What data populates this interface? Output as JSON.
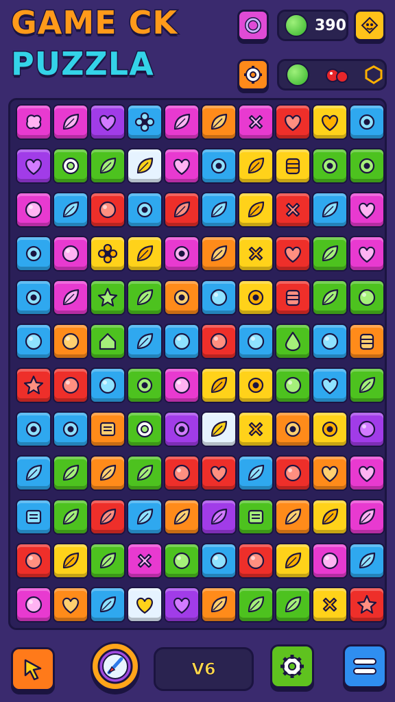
{
  "header": {
    "title_line1": "GAME CK",
    "title_line2": "PUZZLA",
    "coins": "390",
    "icons": [
      "ring-button-icon",
      "coin-icon",
      "hint-face-icon",
      "settings-gear-icon",
      "green-orb-icon",
      "red-cherries-icon",
      "shield-icon"
    ]
  },
  "footer": {
    "level_text": "V6",
    "buttons": [
      "back-arrow-icon",
      "rocket-boost-icon",
      "settings-gear-icon",
      "menu-icon"
    ]
  },
  "colors": {
    "background": "#3a2a6e",
    "outline": "#1b1440",
    "accent_orange": "#ff9a1a",
    "accent_cyan": "#34d3e8",
    "coin_green": "#33b32a"
  },
  "board": {
    "rows": [
      [
        "m:blob",
        "m:leaf",
        "p:heart",
        "c:flower",
        "m:leaf",
        "o:leaf",
        "m:x",
        "r:heart",
        "y:heart",
        "c:ring"
      ],
      [
        "p:heart",
        "g:eye",
        "g:leaf",
        "w:leaf",
        "m:heart",
        "c:ring",
        "y:leaf",
        "y:jar",
        "g:ring",
        "g:ring"
      ],
      [
        "m:circle",
        "c:leaf",
        "r:circle",
        "c:ring",
        "r:leaf",
        "c:leaf",
        "y:leaf",
        "r:x",
        "c:leaf",
        "m:heart"
      ],
      [
        "c:ring",
        "m:circle",
        "y:flower",
        "y:leaf",
        "m:ring",
        "o:leaf",
        "y:x",
        "r:heart",
        "g:leaf",
        "m:heart"
      ],
      [
        "c:ring",
        "m:leaf",
        "g:star",
        "g:leaf",
        "o:ring",
        "c:circle",
        "y:ring",
        "r:jar",
        "g:leaf",
        "g:circle"
      ],
      [
        "c:circle",
        "o:circle",
        "g:house",
        "c:leaf",
        "c:circle",
        "r:circle",
        "c:circle",
        "g:drop",
        "c:circle",
        "o:jar"
      ],
      [
        "r:star",
        "r:circle",
        "c:circle",
        "g:ring",
        "m:circle",
        "y:leaf",
        "y:ring",
        "g:circle",
        "c:heart",
        "g:leaf"
      ],
      [
        "c:ring",
        "c:ring",
        "o:note",
        "g:eye",
        "p:ring",
        "w:leaf",
        "y:x",
        "o:ring",
        "y:ring",
        "p:circle"
      ],
      [
        "c:leaf",
        "g:leaf",
        "o:leaf",
        "g:leaf",
        "r:circle",
        "r:heart",
        "c:leaf",
        "r:circle",
        "o:heart",
        "m:heart"
      ],
      [
        "c:note",
        "g:leaf",
        "r:leaf",
        "c:leaf",
        "o:leaf",
        "p:leaf",
        "g:note",
        "o:leaf",
        "y:leaf",
        "m:leaf"
      ],
      [
        "r:circle",
        "y:leaf",
        "g:leaf",
        "m:x",
        "g:circle",
        "c:circle",
        "r:circle",
        "y:leaf",
        "m:circle",
        "c:leaf"
      ],
      [
        "m:circle",
        "o:heart",
        "c:leaf",
        "w:heart",
        "p:heart",
        "o:leaf",
        "g:leaf",
        "g:leaf",
        "y:x",
        "r:star"
      ]
    ]
  }
}
